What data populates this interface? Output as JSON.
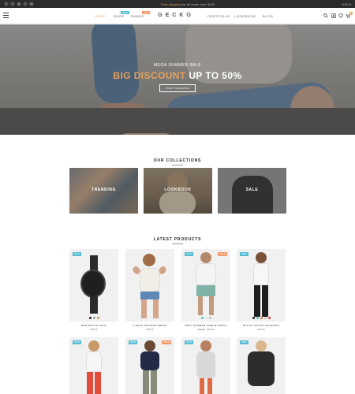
{
  "topbar": {
    "socials": [
      "f",
      "t",
      "p",
      "i",
      "in"
    ],
    "promo_highlight": "Free shipping",
    "promo_rest": " for all order over $100",
    "currency": "USD ▾"
  },
  "header": {
    "logo": "GECKO",
    "nav": {
      "home": "HOME",
      "shop": "SHOP",
      "shop_badge": "NEW",
      "embed": "EMBED",
      "embed_badge": "HOT",
      "portfolio": "PORTFOLIO",
      "lookbook": "LOOKBOOK",
      "blog": "BLOG"
    },
    "cart_count": "0",
    "icons": [
      "menu-icon",
      "search-icon",
      "user-icon",
      "heart-icon",
      "cart-icon"
    ]
  },
  "hero": {
    "subtitle": "MEGA SUMMER SALE",
    "title_accent": "BIG DISCOUNT",
    "title_rest": " UP TO 50%",
    "button": "START SHOPPING"
  },
  "collections": {
    "title": "OUR COLLECTIONS",
    "items": [
      {
        "label": "TRENDING"
      },
      {
        "label": "LOOKBOOK"
      },
      {
        "label": "SALE"
      }
    ]
  },
  "products": {
    "title": "LATEST PRODUCTS",
    "items": [
      {
        "name": "NEW WATCH GOLD",
        "price": "$50.00",
        "old_price": "",
        "tags": [
          "new"
        ]
      },
      {
        "name": "V-NECK PATTERN DRESS",
        "price": "$30.00",
        "old_price": "",
        "tags": []
      },
      {
        "name": "BOXY SUMMER SLEEVE PANTS",
        "price": "$30.00",
        "old_price": "$40.00",
        "tags": [
          "new",
          "sale"
        ]
      },
      {
        "name": "BLACK COTTON LEGGINGS",
        "price": "$45.00",
        "old_price": "",
        "tags": [
          "new"
        ]
      },
      {
        "name": "",
        "price": "",
        "old_price": "",
        "tags": [
          "new"
        ]
      },
      {
        "name": "",
        "price": "",
        "old_price": "",
        "tags": [
          "new",
          "sale"
        ]
      },
      {
        "name": "",
        "price": "",
        "old_price": "",
        "tags": [
          "new"
        ]
      },
      {
        "name": "",
        "price": "",
        "old_price": "",
        "tags": [
          "new"
        ]
      }
    ],
    "tag_labels": {
      "new": "NEW",
      "sale": "SALE"
    }
  },
  "colors": {
    "accent": "#e6a15c",
    "topbar_bg": "#2b2b2b",
    "new_badge": "#55bcd6",
    "sale_badge": "#f39a69"
  }
}
